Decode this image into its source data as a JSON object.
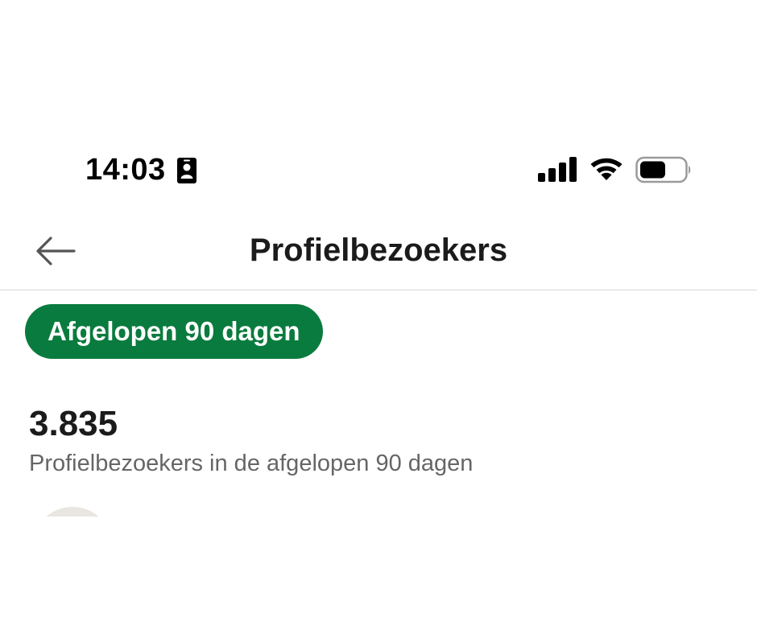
{
  "status_bar": {
    "time": "14:03",
    "icons": [
      "contact-card-icon",
      "cellular-signal-icon",
      "wifi-icon",
      "battery-icon"
    ]
  },
  "header": {
    "back_icon": "arrow-left-icon",
    "title": "Profielbezoekers"
  },
  "filter": {
    "label": "Afgelopen 90 dagen",
    "color": "#0a7b3e"
  },
  "stats": {
    "value": "3.835",
    "caption": "Profielbezoekers in de afgelopen 90 dagen"
  },
  "colors": {
    "accent": "#0a7b3e",
    "text_primary": "#1b1b1b",
    "text_secondary": "#666666",
    "divider": "#d6d6d6"
  }
}
